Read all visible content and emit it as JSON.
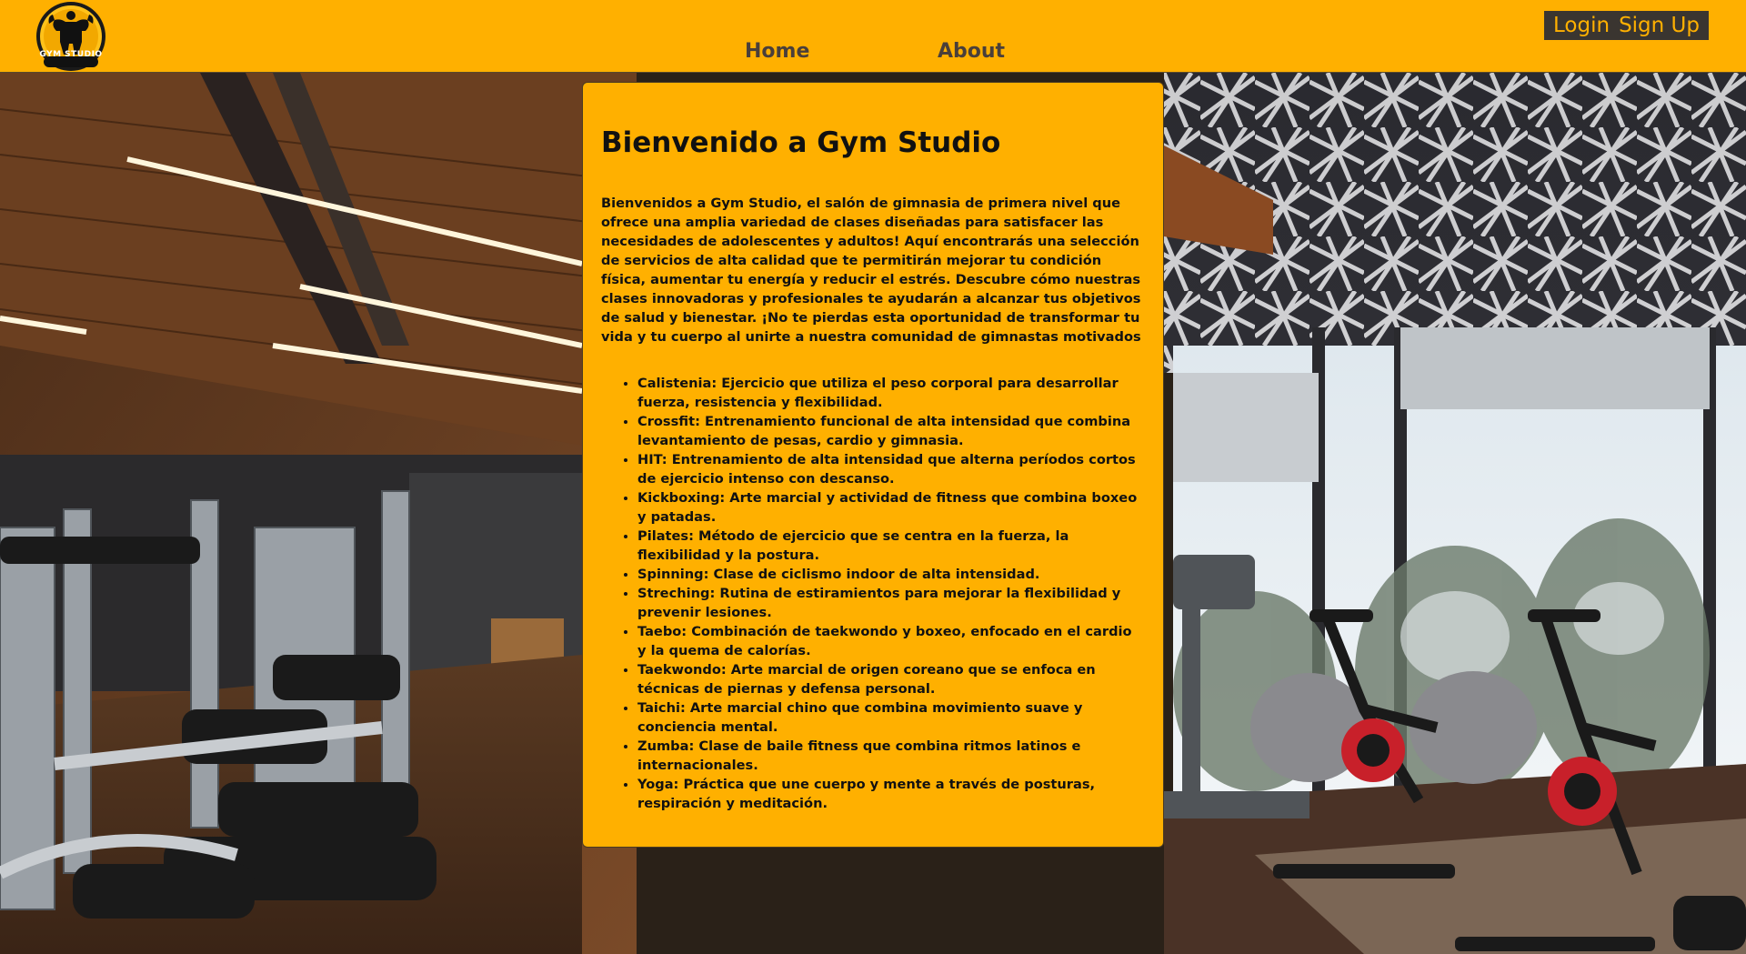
{
  "brand": {
    "logo_text": "GYM STUDIO"
  },
  "nav": {
    "home": "Home",
    "about": "About"
  },
  "auth": {
    "login": "Login",
    "signup": "Sign Up"
  },
  "main": {
    "title": "Bienvenido a Gym Studio",
    "intro": "Bienvenidos a Gym Studio, el salón de gimnasia de primera nivel que ofrece una amplia variedad de clases diseñadas para satisfacer las necesidades de adolescentes y adultos! Aquí encontrarás una selección de servicios de alta calidad que te permitirán mejorar tu condición física, aumentar tu energía y reducir el estrés. Descubre cómo nuestras clases innovadoras y profesionales te ayudarán a alcanzar tus objetivos de salud y bienestar. ¡No te pierdas esta oportunidad de transformar tu vida y tu cuerpo al unirte a nuestra comunidad de gimnastas motivados",
    "classes": [
      "Calistenia: Ejercicio que utiliza el peso corporal para desarrollar fuerza, resistencia y flexibilidad.",
      "Crossfit: Entrenamiento funcional de alta intensidad que combina levantamiento de pesas, cardio y gimnasia.",
      "HIT: Entrenamiento de alta intensidad que alterna períodos cortos de ejercicio intenso con descanso.",
      "Kickboxing: Arte marcial y actividad de fitness que combina boxeo y patadas.",
      "Pilates: Método de ejercicio que se centra en la fuerza, la flexibilidad y la postura.",
      "Spinning: Clase de ciclismo indoor de alta intensidad.",
      "Streching: Rutina de estiramientos para mejorar la flexibilidad y prevenir lesiones.",
      "Taebo: Combinación de taekwondo y boxeo, enfocado en el cardio y la quema de calorías.",
      "Taekwondo: Arte marcial de origen coreano que se enfoca en técnicas de piernas y defensa personal.",
      "Taichi: Arte marcial chino que combina movimiento suave y conciencia mental.",
      "Zumba: Clase de baile fitness que combina ritmos latinos e internacionales.",
      "Yoga: Práctica que une cuerpo y mente a través de posturas, respiración y meditación."
    ]
  },
  "colors": {
    "accent": "#ffb000",
    "auth_bg": "#3a3530",
    "nav_text": "#4a3f3a",
    "text": "#111111"
  },
  "icons": {
    "logo": "bodybuilder-silhouette-icon"
  }
}
